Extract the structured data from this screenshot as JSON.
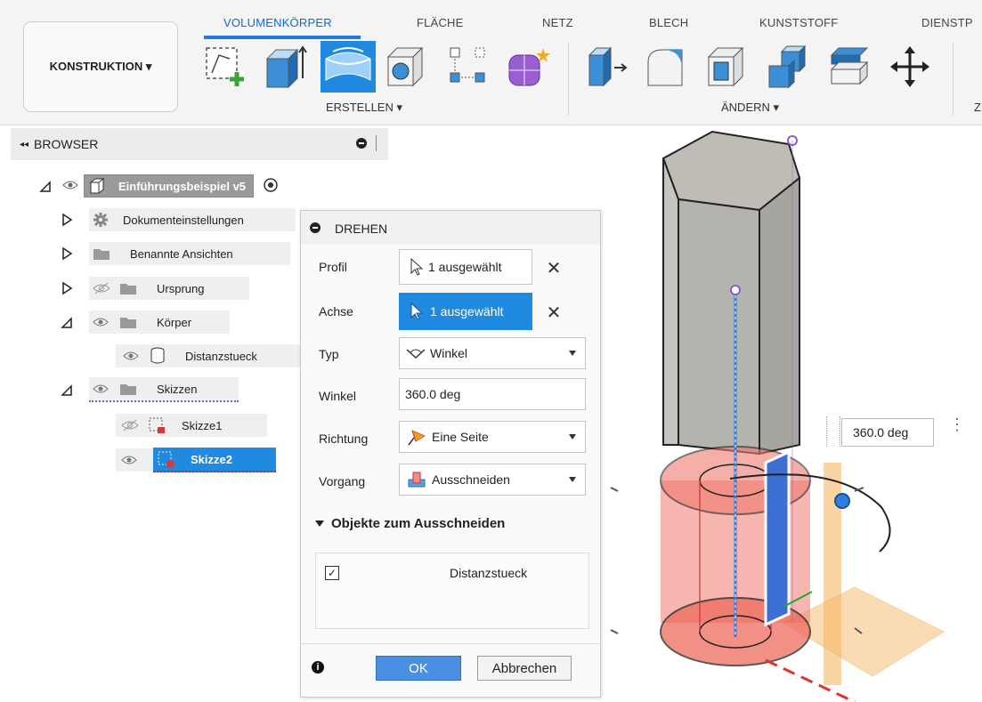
{
  "toolbar": {
    "workspace_label": "KONSTRUKTION ▾",
    "tabs": [
      "VOLUMENKÖRPER",
      "FLÄCHE",
      "NETZ",
      "BLECH",
      "KUNSTSTOFF",
      "DIENSTP"
    ],
    "groups": {
      "create": "ERSTELLEN ▾",
      "modify": "ÄNDERN ▾",
      "clipped": "Z"
    },
    "accent_color": "#1f7be0"
  },
  "browser": {
    "title": "BROWSER",
    "collapse_glyph": "◂◂",
    "root": "Einführungsbeispiel v5",
    "items": [
      {
        "label": "Dokumenteinstellungen"
      },
      {
        "label": "Benannte Ansichten"
      },
      {
        "label": "Ursprung"
      },
      {
        "label": "Körper"
      },
      {
        "label": "Distanzstueck"
      },
      {
        "label": "Skizzen"
      },
      {
        "label": "Skizze1"
      },
      {
        "label": "Skizze2"
      }
    ]
  },
  "dialog": {
    "title": "DREHEN",
    "profile_label": "Profil",
    "profile_value": "1 ausgewählt",
    "axis_label": "Achse",
    "axis_value": "1 ausgewählt",
    "type_label": "Typ",
    "type_value": "Winkel",
    "angle_label": "Winkel",
    "angle_value": "360.0 deg",
    "direction_label": "Richtung",
    "direction_value": "Eine Seite",
    "operation_label": "Vorgang",
    "operation_value": "Ausschneiden",
    "section_title": "Objekte zum Ausschneiden",
    "cut_objects": [
      {
        "label": "Distanzstueck",
        "checked": true
      }
    ],
    "ok_label": "OK",
    "cancel_label": "Abbrechen"
  },
  "viewport": {
    "angle_input": "360.0 deg"
  }
}
